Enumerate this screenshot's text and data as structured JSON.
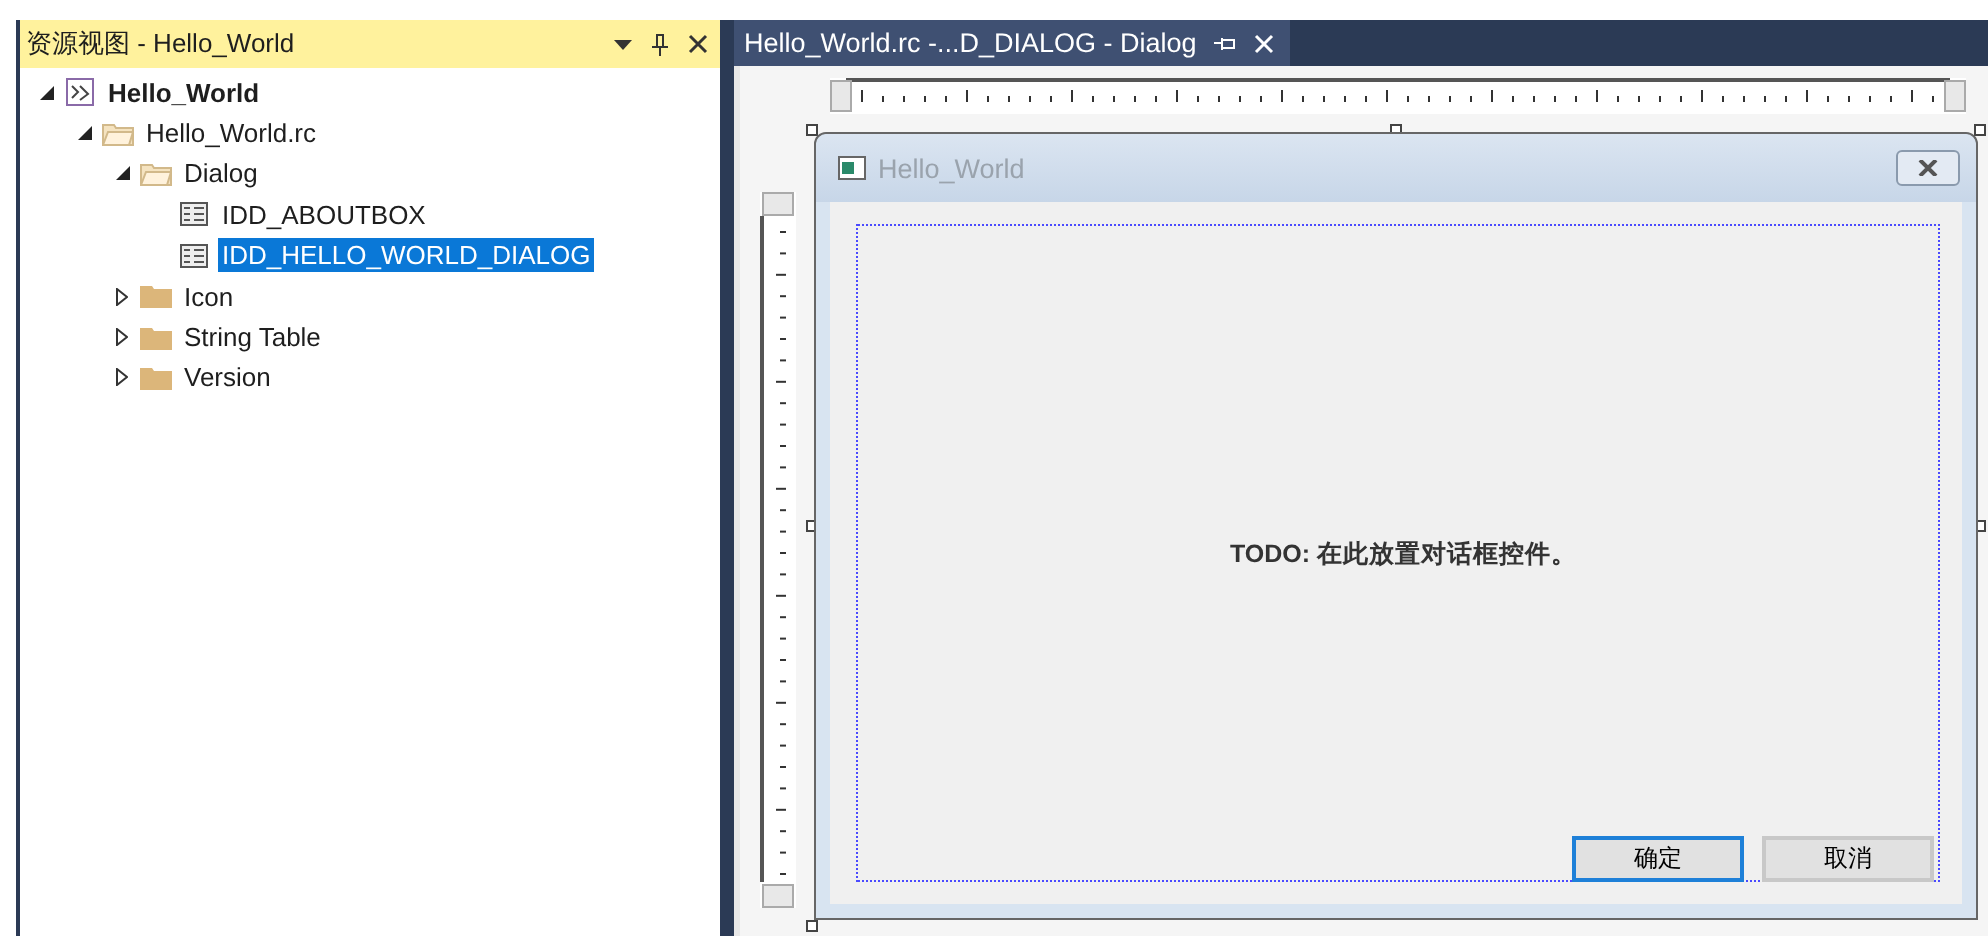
{
  "resource_view": {
    "title": "资源视图 - Hello_World",
    "tree": [
      {
        "label": "Hello_World",
        "kind": "project",
        "expanded": true,
        "selected": false,
        "children": [
          {
            "label": "Hello_World.rc",
            "kind": "folder-open",
            "expanded": true,
            "selected": false,
            "children": [
              {
                "label": "Dialog",
                "kind": "folder-open",
                "expanded": true,
                "selected": false,
                "children": [
                  {
                    "label": "IDD_ABOUTBOX",
                    "kind": "dialog",
                    "selected": false
                  },
                  {
                    "label": "IDD_HELLO_WORLD_DIALOG",
                    "kind": "dialog",
                    "selected": true
                  }
                ]
              },
              {
                "label": "Icon",
                "kind": "folder",
                "expanded": false,
                "selected": false
              },
              {
                "label": "String Table",
                "kind": "folder",
                "expanded": false,
                "selected": false
              },
              {
                "label": "Version",
                "kind": "folder",
                "expanded": false,
                "selected": false
              }
            ]
          }
        ]
      }
    ]
  },
  "editor_tab": {
    "label": "Hello_World.rc -...D_DIALOG - Dialog"
  },
  "dialog": {
    "title": "Hello_World",
    "text": "TODO: 在此放置对话框控件。",
    "buttons": [
      {
        "label": "确定",
        "default": true
      },
      {
        "label": "取消",
        "default": false
      }
    ]
  }
}
